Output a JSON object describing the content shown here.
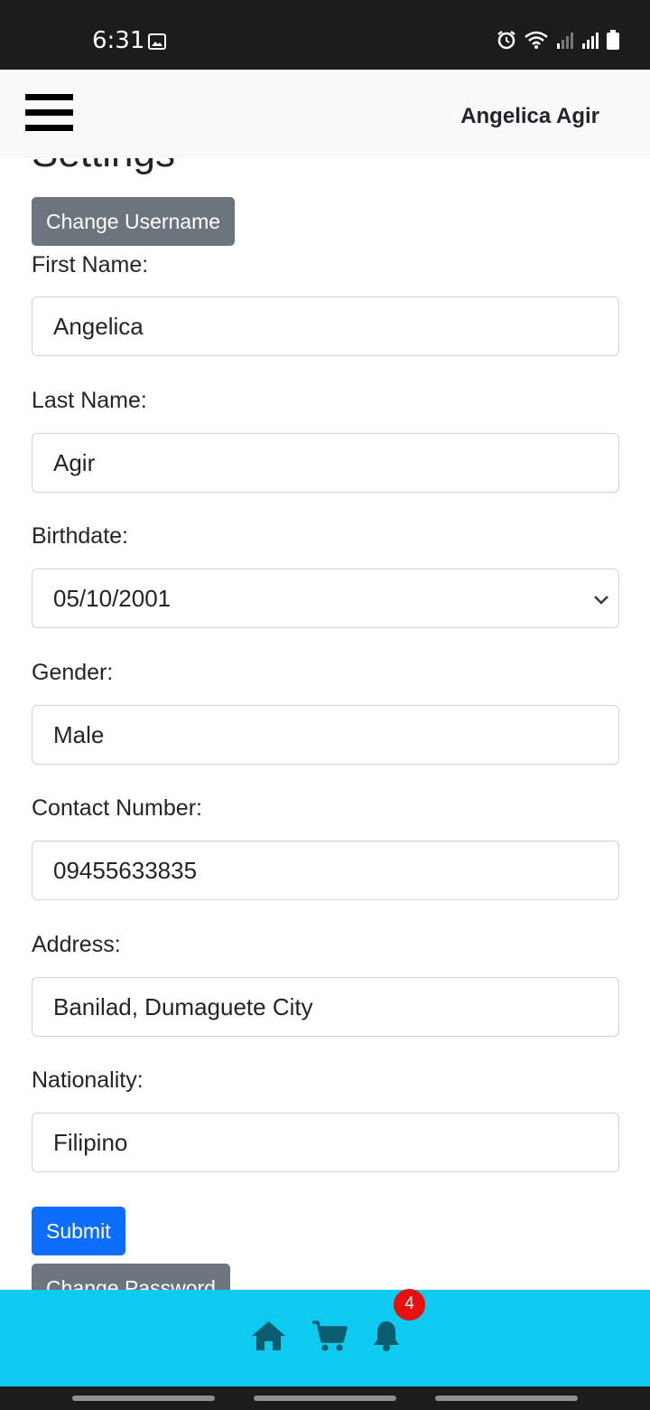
{
  "status_bar": {
    "time": "6:31"
  },
  "app_bar": {
    "user_name": "Angelica Agir"
  },
  "page": {
    "title": "Settings",
    "change_username_label": "Change Username",
    "submit_label": "Submit",
    "change_password_label": "Change Password"
  },
  "form": {
    "first_name": {
      "label": "First Name:",
      "value": "Angelica"
    },
    "last_name": {
      "label": "Last Name:",
      "value": "Agir"
    },
    "birthdate": {
      "label": "Birthdate:",
      "value": "05/10/2001"
    },
    "gender": {
      "label": "Gender:",
      "value": "Male"
    },
    "contact": {
      "label": "Contact Number:",
      "value": "09455633835"
    },
    "address": {
      "label": "Address:",
      "value": "Banilad, Dumaguete City"
    },
    "nationality": {
      "label": "Nationality:",
      "value": "Filipino"
    }
  },
  "bottom_nav": {
    "items": [
      "home-icon",
      "cart-icon",
      "bell-icon"
    ],
    "notification_count": "4"
  },
  "colors": {
    "primary": "#0d6efd",
    "secondary": "#6c757d",
    "nav_bg": "#0dcaf0",
    "nav_icon": "#0a5c6e",
    "badge": "#e8100f"
  }
}
